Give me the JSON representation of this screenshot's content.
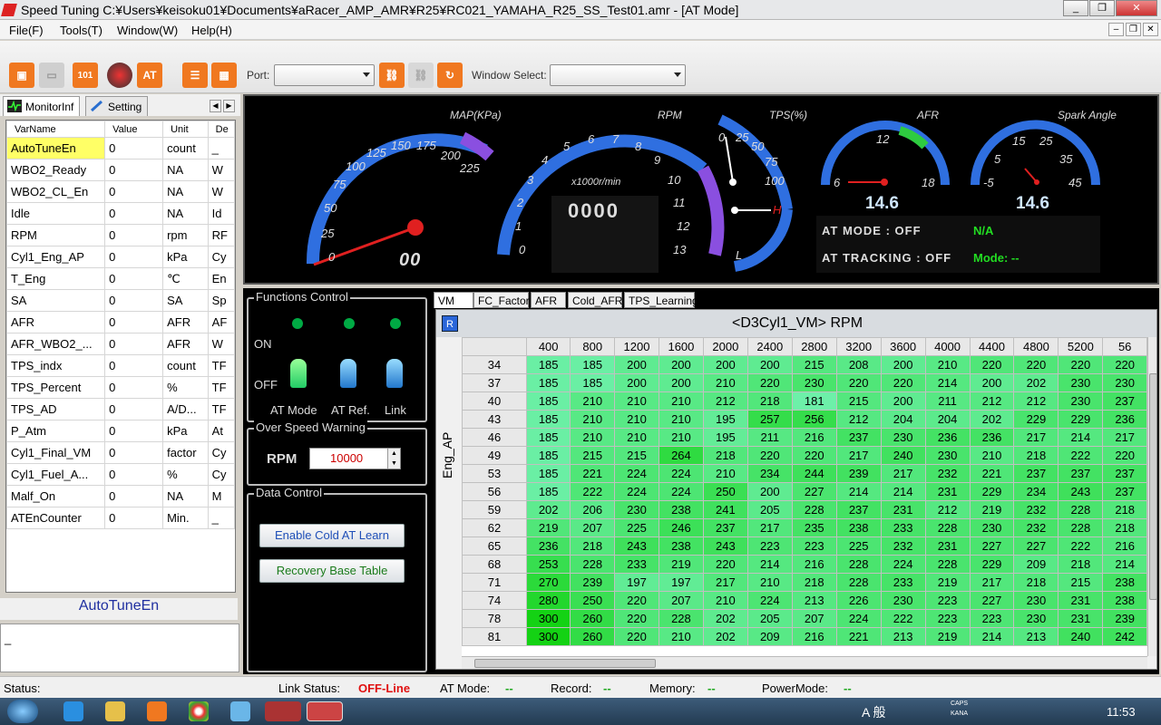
{
  "window": {
    "title": "Speed Tuning   C:¥Users¥keisoku01¥Documents¥aRacer_AMP_AMR¥R25¥RC021_YAMAHA_R25_SS_Test01.amr - [AT Mode]"
  },
  "menu": {
    "file": "File(F)",
    "tools": "Tools(T)",
    "window": "Window(W)",
    "help": "Help(H)"
  },
  "toolbar": {
    "port_label": "Port:",
    "port_value": "",
    "window_select_label": "Window Select:",
    "window_select_value": "",
    "at_label": "AT",
    "bin_label": "101"
  },
  "left_tabs": {
    "monitor": "MonitorInf",
    "setting": "Setting"
  },
  "var_table": {
    "headers": [
      "VarName",
      "Value",
      "Unit",
      "De"
    ],
    "rows": [
      [
        "AutoTuneEn",
        "0",
        "count",
        "_"
      ],
      [
        "WBO2_Ready",
        "0",
        "NA",
        "W"
      ],
      [
        "WBO2_CL_En",
        "0",
        "NA",
        "W"
      ],
      [
        "Idle",
        "0",
        "NA",
        "Id"
      ],
      [
        "RPM",
        "0",
        "rpm",
        "RF"
      ],
      [
        "Cyl1_Eng_AP",
        "0",
        "kPa",
        "Cy"
      ],
      [
        "T_Eng",
        "0",
        "℃",
        "En"
      ],
      [
        "SA",
        "0",
        "SA",
        "Sp"
      ],
      [
        "AFR",
        "0",
        "AFR",
        "AF"
      ],
      [
        "AFR_WBO2_...",
        "0",
        "AFR",
        "W"
      ],
      [
        "TPS_indx",
        "0",
        "count",
        "TF"
      ],
      [
        "TPS_Percent",
        "0",
        "%",
        "TF"
      ],
      [
        "TPS_AD",
        "0",
        "A/D...",
        "TF"
      ],
      [
        "P_Atm",
        "0",
        "kPa",
        "At"
      ],
      [
        "Cyl1_Final_VM",
        "0",
        "factor",
        "Cy"
      ],
      [
        "Cyl1_Fuel_A...",
        "0",
        "%",
        "Cy"
      ],
      [
        "Malf_On",
        "0",
        "NA",
        "M"
      ],
      [
        "ATEnCounter",
        "0",
        "Min.",
        "_"
      ]
    ]
  },
  "selected_var": "AutoTuneEn",
  "log_text": "_",
  "gauges": {
    "map": {
      "title": "MAP(KPa)",
      "ticks": [
        "0",
        "25",
        "50",
        "75",
        "100",
        "125",
        "150",
        "175",
        "200",
        "225"
      ],
      "readout": "00"
    },
    "rpm": {
      "title": "RPM",
      "ticks": [
        "0",
        "1",
        "2",
        "3",
        "4",
        "5",
        "6",
        "7",
        "8",
        "9",
        "10",
        "11",
        "12",
        "13"
      ],
      "unit": "x1000r/min",
      "readout": "0000"
    },
    "tps": {
      "title": "TPS(%)",
      "ticks": [
        "0",
        "25",
        "50",
        "75",
        "100"
      ],
      "h": "H",
      "l": "L"
    },
    "afr": {
      "title": "AFR",
      "ticks": [
        "6",
        "12",
        "18"
      ],
      "readout": "14.6"
    },
    "spark": {
      "title": "Spark Angle",
      "ticks": [
        "-5",
        "5",
        "15",
        "25",
        "35",
        "45"
      ],
      "readout": "14.6"
    },
    "at_mode": "AT MODE : OFF",
    "at_tracking": "AT TRACKING : OFF",
    "na": "N/A",
    "mode": "Mode: --"
  },
  "functions_control": {
    "caption": "Functions Control",
    "on": "ON",
    "off": "OFF",
    "labels": [
      "AT Mode",
      "AT Ref.",
      "Link"
    ]
  },
  "over_speed": {
    "caption": "Over Speed Warning",
    "label": "RPM",
    "value": "10000"
  },
  "data_control": {
    "caption": "Data Control",
    "enable_btn": "Enable Cold AT Learn",
    "recovery_btn": "Recovery Base Table"
  },
  "map_tabs": [
    "VM",
    "FC_Factor",
    "AFR",
    "Cold_AFR",
    "TPS_Learning"
  ],
  "vm_table": {
    "title": "<D3Cyl1_VM>  RPM",
    "r_button": "R",
    "y_label": "Eng_AP",
    "cols": [
      "400",
      "800",
      "1200",
      "1600",
      "2000",
      "2400",
      "2800",
      "3200",
      "3600",
      "4000",
      "4400",
      "4800",
      "5200",
      "56"
    ],
    "rows": [
      {
        "ap": "34",
        "v": [
          "185",
          "185",
          "200",
          "200",
          "200",
          "200",
          "215",
          "208",
          "200",
          "210",
          "220",
          "220",
          "220",
          "220"
        ]
      },
      {
        "ap": "37",
        "v": [
          "185",
          "185",
          "200",
          "200",
          "210",
          "220",
          "230",
          "220",
          "220",
          "214",
          "200",
          "202",
          "230",
          "230"
        ]
      },
      {
        "ap": "40",
        "v": [
          "185",
          "210",
          "210",
          "210",
          "212",
          "218",
          "181",
          "215",
          "200",
          "211",
          "212",
          "212",
          "230",
          "237"
        ]
      },
      {
        "ap": "43",
        "v": [
          "185",
          "210",
          "210",
          "210",
          "195",
          "257",
          "256",
          "212",
          "204",
          "204",
          "202",
          "229",
          "229",
          "236"
        ]
      },
      {
        "ap": "46",
        "v": [
          "185",
          "210",
          "210",
          "210",
          "195",
          "211",
          "216",
          "237",
          "230",
          "236",
          "236",
          "217",
          "214",
          "217"
        ]
      },
      {
        "ap": "49",
        "v": [
          "185",
          "215",
          "215",
          "264",
          "218",
          "220",
          "220",
          "217",
          "240",
          "230",
          "210",
          "218",
          "222",
          "220"
        ]
      },
      {
        "ap": "53",
        "v": [
          "185",
          "221",
          "224",
          "224",
          "210",
          "234",
          "244",
          "239",
          "217",
          "232",
          "221",
          "237",
          "237",
          "237"
        ]
      },
      {
        "ap": "56",
        "v": [
          "185",
          "222",
          "224",
          "224",
          "250",
          "200",
          "227",
          "214",
          "214",
          "231",
          "229",
          "234",
          "243",
          "237"
        ]
      },
      {
        "ap": "59",
        "v": [
          "202",
          "206",
          "230",
          "238",
          "241",
          "205",
          "228",
          "237",
          "231",
          "212",
          "219",
          "232",
          "228",
          "218"
        ]
      },
      {
        "ap": "62",
        "v": [
          "219",
          "207",
          "225",
          "246",
          "237",
          "217",
          "235",
          "238",
          "233",
          "228",
          "230",
          "232",
          "228",
          "218"
        ]
      },
      {
        "ap": "65",
        "v": [
          "236",
          "218",
          "243",
          "238",
          "243",
          "223",
          "223",
          "225",
          "232",
          "231",
          "227",
          "227",
          "222",
          "216"
        ]
      },
      {
        "ap": "68",
        "v": [
          "253",
          "228",
          "233",
          "219",
          "220",
          "214",
          "216",
          "228",
          "224",
          "228",
          "229",
          "209",
          "218",
          "214"
        ]
      },
      {
        "ap": "71",
        "v": [
          "270",
          "239",
          "197",
          "197",
          "217",
          "210",
          "218",
          "228",
          "233",
          "219",
          "217",
          "218",
          "215",
          "238"
        ]
      },
      {
        "ap": "74",
        "v": [
          "280",
          "250",
          "220",
          "207",
          "210",
          "224",
          "213",
          "226",
          "230",
          "223",
          "227",
          "230",
          "231",
          "238"
        ]
      },
      {
        "ap": "78",
        "v": [
          "300",
          "260",
          "220",
          "228",
          "202",
          "205",
          "207",
          "224",
          "222",
          "223",
          "223",
          "230",
          "231",
          "239"
        ]
      },
      {
        "ap": "81",
        "v": [
          "300",
          "260",
          "220",
          "210",
          "202",
          "209",
          "216",
          "221",
          "213",
          "219",
          "214",
          "213",
          "240",
          "242"
        ]
      }
    ]
  },
  "status": {
    "status_label": "Status:",
    "link_label": "Link Status:",
    "link_value": "OFF-Line",
    "at_mode_label": "AT Mode:",
    "at_mode_value": "--",
    "record_label": "Record:",
    "record_value": "--",
    "memory_label": "Memory:",
    "memory_value": "--",
    "power_label": "PowerMode:",
    "power_value": "--"
  },
  "taskbar": {
    "time": "11:53",
    "ime": "A 般",
    "caps": "CAPS",
    "kana": "KANA"
  },
  "colors": {
    "accent_orange": "#f07820",
    "gauge_blue": "#2f6fe0",
    "link_offline": "#e01010",
    "status_green": "#22dd22",
    "highlight_yellow": "#ffff66"
  }
}
